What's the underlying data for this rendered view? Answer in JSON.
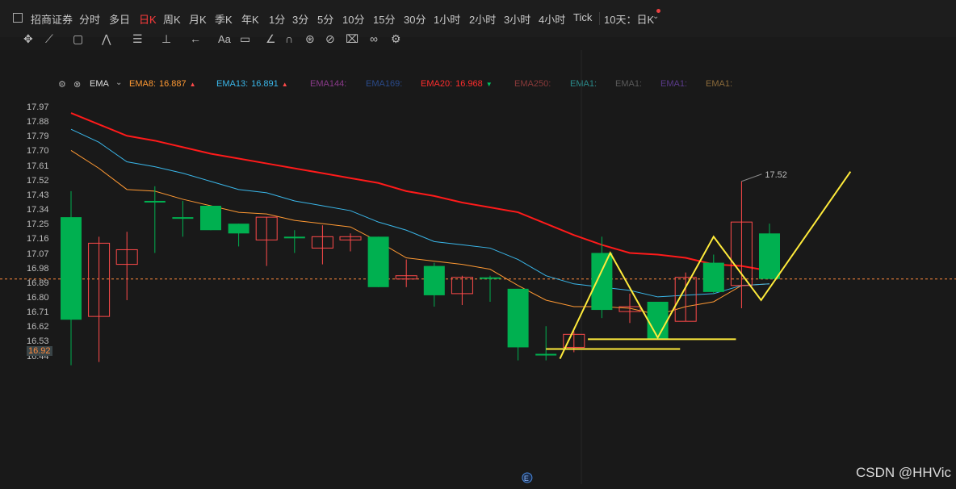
{
  "toolbar": {
    "broker": "招商证券",
    "periods": [
      "分时",
      "多日",
      "日K",
      "周K",
      "月K",
      "季K",
      "年K",
      "1分",
      "3分",
      "5分",
      "10分",
      "15分",
      "30分",
      "1小时",
      "2小时",
      "3小时",
      "4小时",
      "Tick"
    ],
    "active_period": "日K",
    "range_selector": "10天：日K"
  },
  "indicator_bar": {
    "name": "EMA",
    "items": [
      {
        "label": "EMA8:",
        "value": "16.887",
        "color": "#ff9933",
        "arrow": "▲"
      },
      {
        "label": "EMA13:",
        "value": "16.891",
        "color": "#3ab7ea",
        "arrow": "▲"
      },
      {
        "label": "EMA144:",
        "value": "",
        "color": "#8a3a8a",
        "arrow": ""
      },
      {
        "label": "EMA169:",
        "value": "",
        "color": "#2a4a8a",
        "arrow": ""
      },
      {
        "label": "EMA20:",
        "value": "16.968",
        "color": "#ff2d2d",
        "arrow": "▼"
      },
      {
        "label": "EMA250:",
        "value": "",
        "color": "#8a3a3a",
        "arrow": ""
      },
      {
        "label": "EMA1:",
        "value": "",
        "color": "#2a8a8a",
        "arrow": ""
      },
      {
        "label": "EMA1:",
        "value": "",
        "color": "#5a5a5a",
        "arrow": ""
      },
      {
        "label": "EMA1:",
        "value": "",
        "color": "#5a3a8a",
        "arrow": ""
      },
      {
        "label": "EMA1:",
        "value": "",
        "color": "#8a6a3a",
        "arrow": ""
      }
    ]
  },
  "chart_data": {
    "type": "candlestick",
    "y_ticks": [
      "17.97",
      "17.88",
      "17.79",
      "17.70",
      "17.61",
      "17.52",
      "17.43",
      "17.34",
      "17.25",
      "17.16",
      "17.07",
      "16.98",
      "16.89",
      "16.80",
      "16.71",
      "16.62",
      "16.53",
      "16.44"
    ],
    "ylim": [
      16.39,
      18.02
    ],
    "current_price": "16.92",
    "high_annotation": "17.52",
    "colors": {
      "up": "#ff4a4a",
      "down": "#00b050",
      "ema8": "#ff9933",
      "ema13": "#3ab7ea",
      "ema20": "#ff1a1a",
      "annotation": "#ffeb3b",
      "current_line": "#ff8a3d"
    },
    "candles": [
      {
        "o": 17.3,
        "c": 16.67,
        "h": 17.46,
        "l": 16.39
      },
      {
        "o": 16.69,
        "c": 17.14,
        "h": 17.18,
        "l": 16.41
      },
      {
        "o": 17.01,
        "c": 17.1,
        "h": 17.21,
        "l": 16.79
      },
      {
        "o": 17.4,
        "c": 17.39,
        "h": 17.49,
        "l": 17.08
      },
      {
        "o": 17.3,
        "c": 17.29,
        "h": 17.4,
        "l": 17.18
      },
      {
        "o": 17.37,
        "c": 17.22,
        "h": 17.37,
        "l": 17.22
      },
      {
        "o": 17.26,
        "c": 17.2,
        "h": 17.26,
        "l": 17.12
      },
      {
        "o": 17.16,
        "c": 17.3,
        "h": 17.3,
        "l": 17.0
      },
      {
        "o": 17.18,
        "c": 17.18,
        "h": 17.22,
        "l": 17.08
      },
      {
        "o": 17.11,
        "c": 17.18,
        "h": 17.25,
        "l": 17.01
      },
      {
        "o": 17.16,
        "c": 17.18,
        "h": 17.2,
        "l": 17.09
      },
      {
        "o": 17.18,
        "c": 16.87,
        "h": 17.18,
        "l": 16.87
      },
      {
        "o": 16.92,
        "c": 16.94,
        "h": 17.04,
        "l": 16.87
      },
      {
        "o": 17.0,
        "c": 16.82,
        "h": 17.02,
        "l": 16.75
      },
      {
        "o": 16.83,
        "c": 16.93,
        "h": 16.94,
        "l": 16.76
      },
      {
        "o": 16.93,
        "c": 16.92,
        "h": 16.94,
        "l": 16.78
      },
      {
        "o": 16.86,
        "c": 16.5,
        "h": 16.86,
        "l": 16.42
      },
      {
        "o": 16.46,
        "c": 16.45,
        "h": 16.63,
        "l": 16.42
      },
      {
        "o": 16.5,
        "c": 16.58,
        "h": 16.6,
        "l": 16.47
      },
      {
        "o": 17.08,
        "c": 16.73,
        "h": 17.18,
        "l": 16.68
      },
      {
        "o": 16.72,
        "c": 16.75,
        "h": 16.83,
        "l": 16.65
      },
      {
        "o": 16.78,
        "c": 16.55,
        "h": 16.78,
        "l": 16.55
      },
      {
        "o": 16.66,
        "c": 16.93,
        "h": 16.96,
        "l": 16.66
      },
      {
        "o": 17.02,
        "c": 16.84,
        "h": 17.07,
        "l": 16.83
      },
      {
        "o": 16.88,
        "c": 17.27,
        "h": 17.52,
        "l": 16.74
      },
      {
        "o": 17.2,
        "c": 16.92,
        "h": 17.26,
        "l": 16.92
      }
    ],
    "ema8": [
      17.71,
      17.6,
      17.47,
      17.46,
      17.41,
      17.37,
      17.33,
      17.32,
      17.28,
      17.26,
      17.24,
      17.15,
      17.05,
      17.03,
      17.01,
      16.98,
      16.88,
      16.79,
      16.75,
      16.75,
      16.74,
      16.7,
      16.75,
      16.78,
      16.88,
      16.89
    ],
    "ema13": [
      17.84,
      17.76,
      17.64,
      17.61,
      17.57,
      17.52,
      17.47,
      17.45,
      17.4,
      17.37,
      17.34,
      17.27,
      17.22,
      17.15,
      17.13,
      17.11,
      17.04,
      16.94,
      16.89,
      16.87,
      16.85,
      16.81,
      16.82,
      16.83,
      16.88,
      16.89
    ],
    "ema20": [
      17.94,
      17.87,
      17.8,
      17.77,
      17.73,
      17.69,
      17.66,
      17.63,
      17.6,
      17.57,
      17.54,
      17.51,
      17.46,
      17.43,
      17.39,
      17.36,
      17.33,
      17.26,
      17.19,
      17.13,
      17.08,
      17.07,
      17.05,
      17.01,
      17.0,
      16.97
    ],
    "zigzag": [
      [
        17.5,
        16.43
      ],
      [
        19.3,
        17.08
      ],
      [
        21.0,
        16.56
      ],
      [
        23.0,
        17.18
      ],
      [
        24.7,
        16.79
      ],
      [
        27.9,
        17.58
      ]
    ],
    "support_lines": [
      [
        17.0,
        21.8,
        16.49
      ],
      [
        18.5,
        23.8,
        16.55
      ]
    ]
  },
  "watermark": "CSDN @HHVic"
}
